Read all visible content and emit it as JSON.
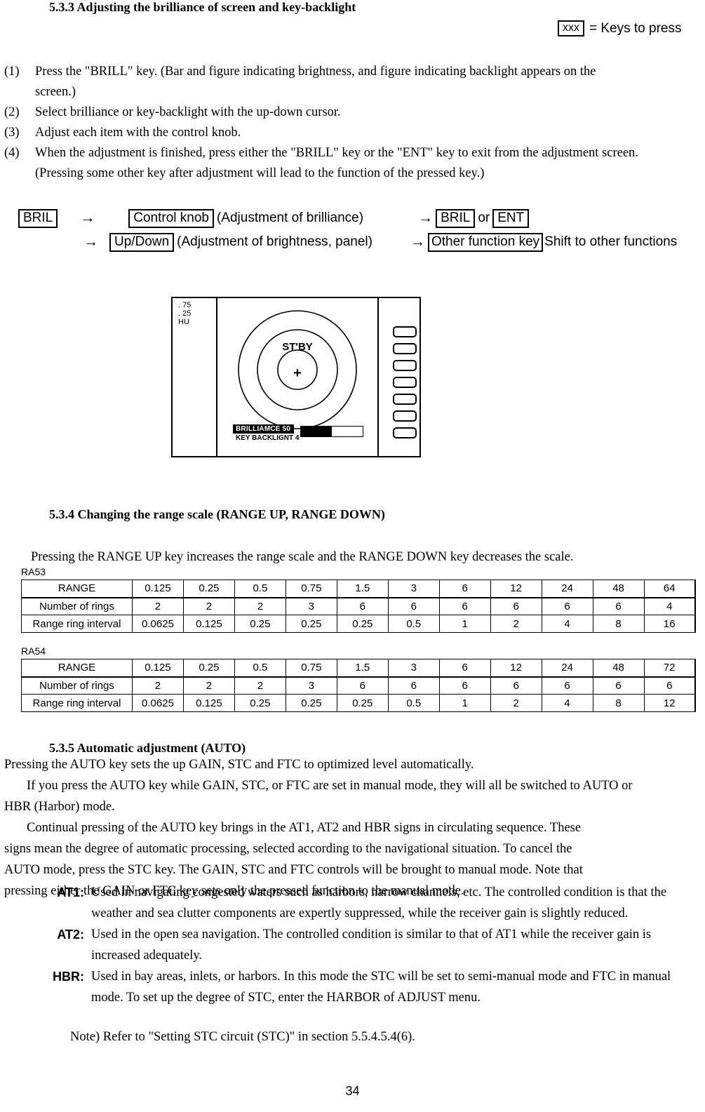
{
  "document": {
    "page_number": "34"
  },
  "legend": {
    "key_sample": "xxx",
    "text": "= Keys to press"
  },
  "section_533": {
    "heading": "5.3.3 Adjusting the brilliance of screen and key-backlight",
    "steps": [
      {
        "num": "(1)",
        "line1": "Press the \"BRILL\" key.  (Bar and figure indicating brightness, and figure indicating backlight appears on the",
        "line2": "screen.)"
      },
      {
        "num": "(2)",
        "line1": "Select brilliance or key-backlight with the up-down cursor.",
        "line2": ""
      },
      {
        "num": "(3)",
        "line1": "Adjust each item with the control knob.",
        "line2": ""
      },
      {
        "num": "(4)",
        "line1": "When the adjustment is finished, press either the \"BRILL\" key or the \"ENT\" key to exit from the adjustment screen.",
        "line2": "(Pressing some other key after adjustment will lead to the function of the pressed key.)"
      }
    ],
    "key_sequence": {
      "row1": {
        "key_start": "BRIL",
        "arrow1": "→",
        "key_action": "Control knob",
        "action_note": "(Adjustment of brilliance)",
        "arrow2": "→",
        "key_exit_a": "BRIL",
        "or": "or",
        "key_exit_b": "ENT"
      },
      "row2": {
        "arrow1": "→",
        "key_action": "Up/Down",
        "action_note": "(Adjustment of brightness, panel)",
        "arrow2": "→",
        "key_exit": "Other function key",
        "exit_note": "Shift to other functions"
      }
    },
    "radar_figure": {
      "corner_labels": [
        ". 75",
        ". 25",
        "HU"
      ],
      "standby_text": "ST'BY",
      "center_marker": "+",
      "osd_brilliance": "BRILLIAMCE   50",
      "osd_backlight": "KEY BACKLIGNT 4",
      "bar_fill_percent": 50,
      "softkey_count": 7
    }
  },
  "section_534": {
    "heading": "5.3.4 Changing the range scale (RANGE UP, RANGE DOWN)",
    "intro": "Pressing the RANGE UP key increases the range scale and the RANGE DOWN key decreases the scale.",
    "tables": [
      {
        "label": "RA53",
        "rows": [
          {
            "header": "RANGE",
            "values": [
              "0.125",
              "0.25",
              "0.5",
              "0.75",
              "1.5",
              "3",
              "6",
              "12",
              "24",
              "48",
              "64"
            ]
          },
          {
            "header": "Number of rings",
            "values": [
              "2",
              "2",
              "2",
              "3",
              "6",
              "6",
              "6",
              "6",
              "6",
              "6",
              "4"
            ]
          },
          {
            "header": "Range ring interval",
            "values": [
              "0.0625",
              "0.125",
              "0.25",
              "0.25",
              "0.25",
              "0.5",
              "1",
              "2",
              "4",
              "8",
              "16"
            ]
          }
        ]
      },
      {
        "label": "RA54",
        "rows": [
          {
            "header": "RANGE",
            "values": [
              "0.125",
              "0.25",
              "0.5",
              "0.75",
              "1.5",
              "3",
              "6",
              "12",
              "24",
              "48",
              "72"
            ]
          },
          {
            "header": "Number of rings",
            "values": [
              "2",
              "2",
              "2",
              "3",
              "6",
              "6",
              "6",
              "6",
              "6",
              "6",
              "6"
            ]
          },
          {
            "header": "Range ring interval",
            "values": [
              "0.0625",
              "0.125",
              "0.25",
              "0.25",
              "0.25",
              "0.5",
              "1",
              "2",
              "4",
              "8",
              "12"
            ]
          }
        ]
      }
    ]
  },
  "section_535": {
    "heading": "5.3.5 Automatic adjustment (AUTO)",
    "para1": " Pressing the AUTO key sets the up GAIN, STC and FTC to optimized level automatically.",
    "para2": "If you press the AUTO key while GAIN, STC, or FTC are set in manual mode, they will all be switched to AUTO or",
    "para2b": "HBR (Harbor) mode.",
    "para3": "Continual pressing of the AUTO key brings in the AT1, AT2 and HBR signs in circulating sequence. These",
    "para3b": "signs mean the degree of automatic processing, selected according to the navigational situation. To cancel the",
    "para3c": "AUTO mode, press the STC key. The GAIN, STC and FTC controls will be brought to manual mode. Note that",
    "para3d": "pressing either the GAIN or FTC key sets only the pressed function to the manual mode.",
    "definitions": [
      {
        "term": "AT1:",
        "desc": "Used in navigating congested waters such as harbors, narrow channels, etc. The controlled condition is that the weather and sea clutter components are expertly suppressed, while the receiver gain is slightly reduced."
      },
      {
        "term": "AT2:",
        "desc": "Used in the open sea navigation. The controlled condition is similar to that of AT1 while the receiver gain is increased adequately."
      },
      {
        "term": "HBR:",
        "desc": "Used in bay areas, inlets, or harbors. In this mode the STC will be set to semi-manual mode and FTC in manual mode. To set up the degree of STC, enter the HARBOR of ADJUST menu."
      }
    ],
    "note": "Note) Refer to \"Setting STC circuit (STC)\" in section 5.5.4.5.4(6)."
  }
}
